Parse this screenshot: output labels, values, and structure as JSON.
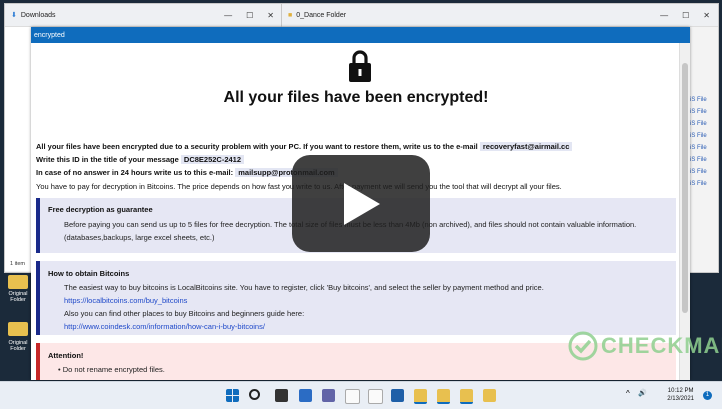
{
  "windows": {
    "downloads_title": "Downloads",
    "folder_title": "0_Dance Folder",
    "items_count": "1 item",
    "right_labels": [
      "iS File",
      "iS File",
      "iS File",
      "iS File",
      "iS File",
      "iS File",
      "iS File",
      "iS File"
    ]
  },
  "ransom": {
    "window_title": "encrypted",
    "headline": "All your files have been encrypted!",
    "line1_text": "All your files have been encrypted due to a security problem with your PC. If you want to restore them, write us to the e-mail",
    "line1_email": "recoveryfast@airmail.cc",
    "line2_text": "Write this ID in the title of your message",
    "line2_id": "DC8E252C-2412",
    "line3_text": "In case of no answer in 24 hours write us to this e-mail:",
    "line3_email": "mailsupp@protonmail.com",
    "line4_text": "You have to pay for decryption in Bitcoins. The price depends on how fast you write to us. After payment we will send you the tool that will decrypt all your files.",
    "box1_title": "Free decryption as guarantee",
    "box1_line1": "Before paying you can send us up to 5 files for free decryption. The total size of files must be less than 4Mb (non archived), and files should not contain valuable information.",
    "box1_line2": "(databases,backups, large excel sheets, etc.)",
    "box2_title": "How to obtain Bitcoins",
    "box2_line1": "The easiest way to buy bitcoins is LocalBitcoins site. You have to register, click 'Buy bitcoins', and select the seller by payment method and price.",
    "box2_link1": "https://localbitcoins.com/buy_bitcoins",
    "box2_line2": "Also you can find other places to buy Bitcoins and beginners guide here:",
    "box2_link2": "http://www.coindesk.com/information/how-can-i-buy-bitcoins/",
    "box3_title": "Attention!",
    "box3_item1": "Do not rename encrypted files."
  },
  "desktop": {
    "icon1_label": "Original Folder",
    "icon2_label": "Original Folder"
  },
  "taskbar": {
    "time": "10:12 PM",
    "date": "2/13/2021",
    "notif_count": "1"
  },
  "watermark": {
    "text": "CHECKMAL"
  },
  "colors": {
    "title_bar": "#0f6cbd",
    "box_blue_border": "#1a2a8a",
    "box_red_border": "#c62828",
    "link": "#1f49c9"
  }
}
